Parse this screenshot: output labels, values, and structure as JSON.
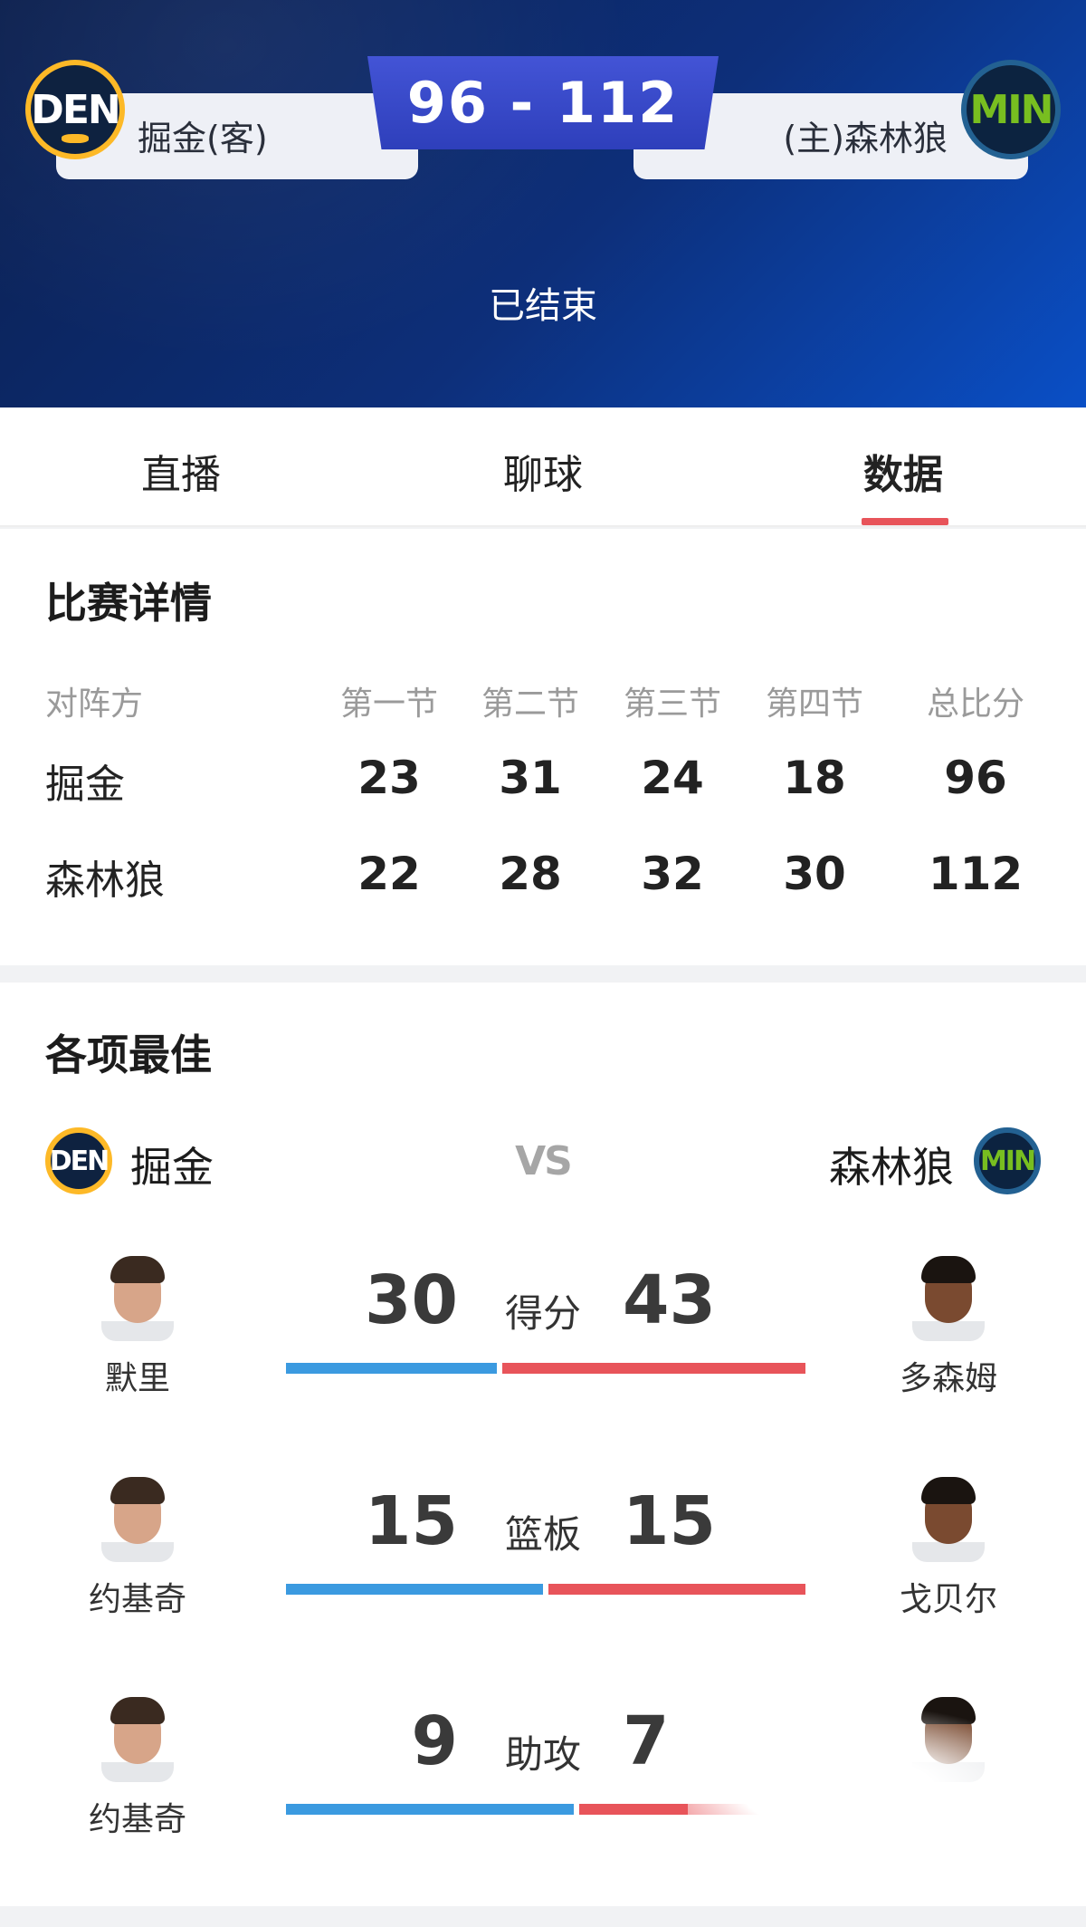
{
  "header": {
    "away_team": "掘金(客)",
    "home_team": "(主)森林狼",
    "score": "96 - 112",
    "status": "已结束",
    "away_logo_text": "DEN",
    "home_logo_text": "MIN"
  },
  "tabs": [
    {
      "label": "直播"
    },
    {
      "label": "聊球"
    },
    {
      "label": "数据",
      "active": true
    }
  ],
  "match_detail": {
    "title": "比赛详情",
    "columns": [
      "对阵方",
      "第一节",
      "第二节",
      "第三节",
      "第四节",
      "总比分"
    ],
    "rows": [
      {
        "team": "掘金",
        "q1": "23",
        "q2": "31",
        "q3": "24",
        "q4": "18",
        "total": "96"
      },
      {
        "team": "森林狼",
        "q1": "22",
        "q2": "28",
        "q3": "32",
        "q4": "30",
        "total": "112"
      }
    ]
  },
  "leaders": {
    "title": "各项最佳",
    "away_team": "掘金",
    "home_team": "森林狼",
    "vs": "VS",
    "stats": [
      {
        "label": "得分",
        "away_player": "默里",
        "away_value": "30",
        "home_player": "多森姆",
        "home_value": "43",
        "away_share": 0.41
      },
      {
        "label": "篮板",
        "away_player": "约基奇",
        "away_value": "15",
        "home_player": "戈贝尔",
        "home_value": "15",
        "away_share": 0.5
      },
      {
        "label": "助攻",
        "away_player": "约基奇",
        "away_value": "9",
        "home_player": "",
        "home_value": "7",
        "away_share": 0.56
      }
    ]
  },
  "colors": {
    "away_bar": "#3b9ae0",
    "home_bar": "#e8545a",
    "tab_indicator": "#e8545a",
    "header_bg": "#0d2f7a",
    "score_box": "#3b4cc8"
  }
}
